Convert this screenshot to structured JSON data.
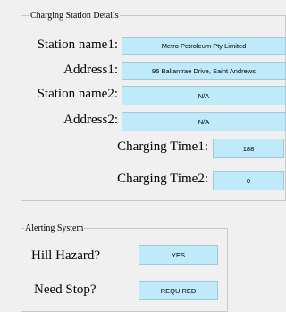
{
  "charging": {
    "title": "Charging Station Details",
    "station_name1_label": "Station name1:",
    "station_name1_value": "Metro Petroleum Pty Limited",
    "address1_label": "Address1:",
    "address1_value": "95 Ballantrae Drive, Saint Andrews",
    "station_name2_label": "Station name2:",
    "station_name2_value": "N/A",
    "address2_label": "Address2:",
    "address2_value": "N/A",
    "charging_time1_label": "Charging Time1:",
    "charging_time1_value": "188",
    "charging_time2_label": "Charging Time2:",
    "charging_time2_value": "0"
  },
  "alerting": {
    "title": "Alerting System",
    "hill_hazard_label": "Hill Hazard?",
    "hill_hazard_value": "YES",
    "need_stop_label": "Need Stop?",
    "need_stop_value": "REQUIRED"
  },
  "colors": {
    "background": "#f0f0f0",
    "field_fill": "#bfeaf9",
    "field_border": "#9ec9da",
    "group_border": "#c8c8c8"
  }
}
